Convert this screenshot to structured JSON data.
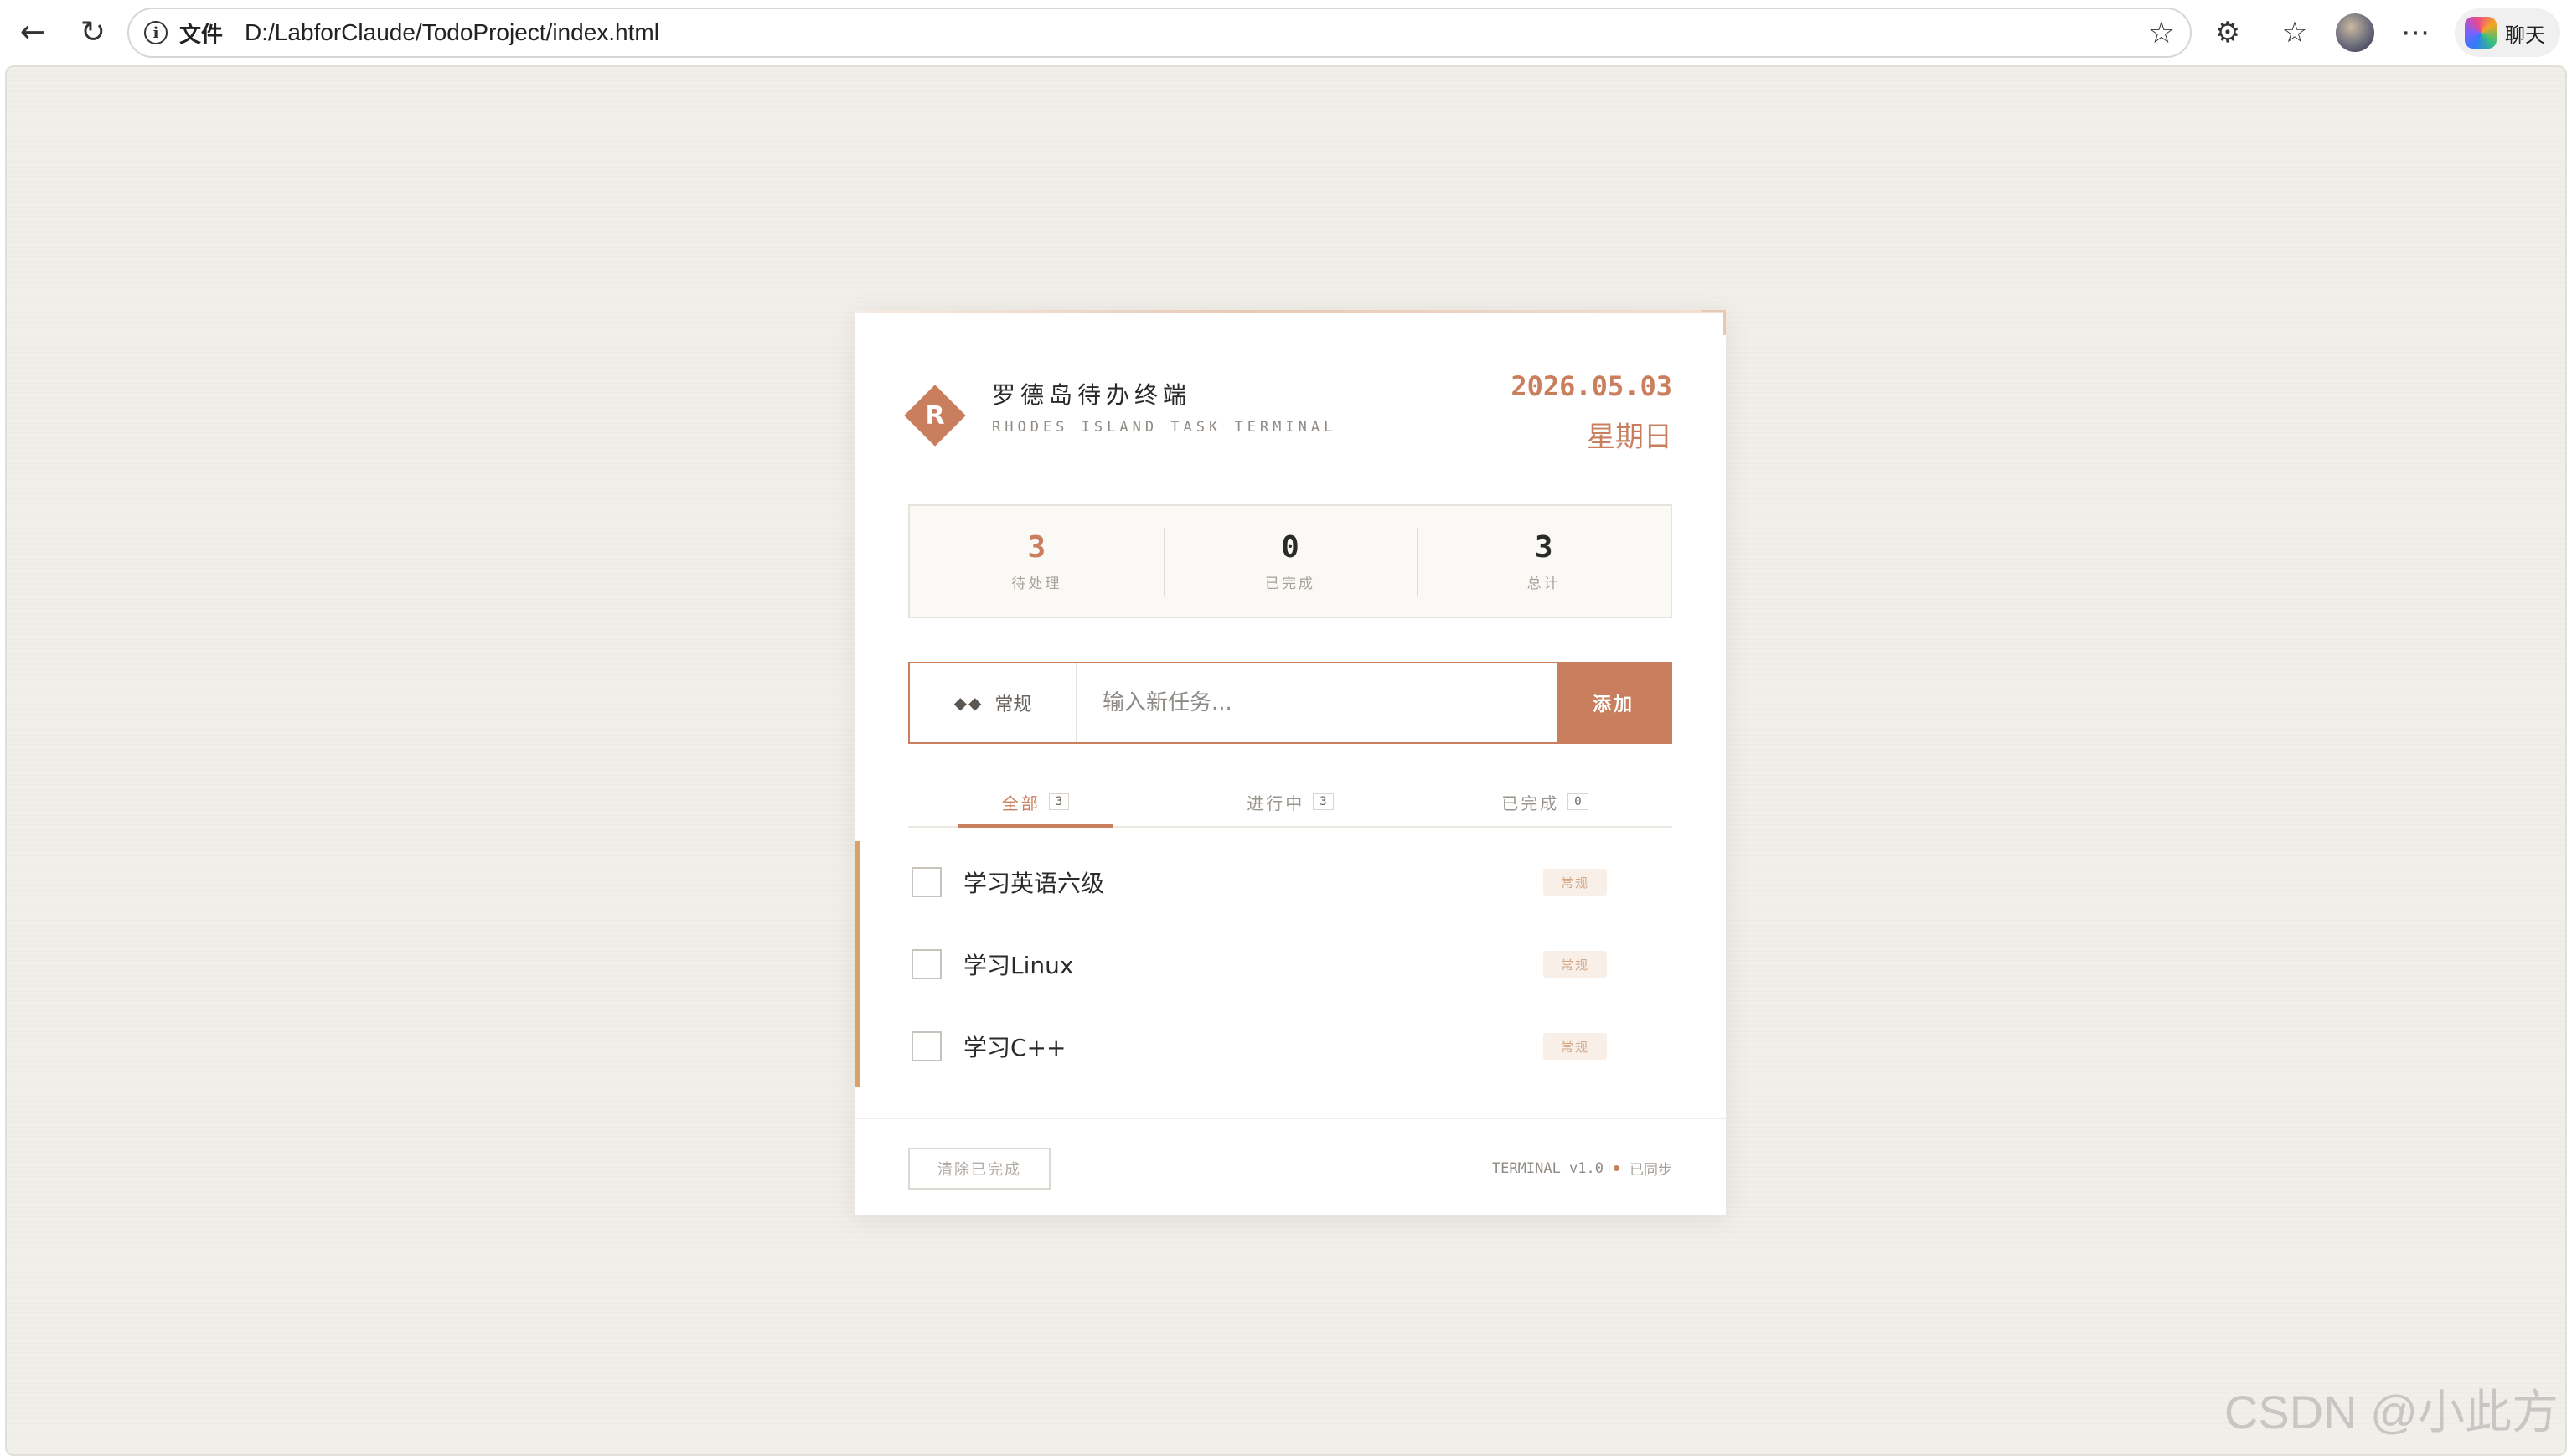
{
  "browser": {
    "address_label": "文件",
    "url": "D:/LabforClaude/TodoProject/index.html",
    "chat_label": "聊天",
    "icons": [
      "back-icon",
      "reload-icon",
      "info-icon",
      "star-icon",
      "extensions-icon",
      "favorites-icon",
      "more-icon",
      "copilot-icon"
    ]
  },
  "app": {
    "logo_letter": "R",
    "title": "罗德岛待办终端",
    "subtitle": "RHODES ISLAND TASK TERMINAL",
    "date": "2026.05.03",
    "weekday": "星期日",
    "accent_color": "#c97f5d"
  },
  "stats": [
    {
      "value": "3",
      "label": "待处理"
    },
    {
      "value": "0",
      "label": "已完成"
    },
    {
      "value": "3",
      "label": "总计"
    }
  ],
  "input": {
    "priority_icon": "◆◆",
    "priority_label": "常规",
    "placeholder": "输入新任务...",
    "add_label": "添加"
  },
  "tabs": [
    {
      "label": "全部",
      "count": "3"
    },
    {
      "label": "进行中",
      "count": "3"
    },
    {
      "label": "已完成",
      "count": "0"
    }
  ],
  "tasks": [
    {
      "text": "学习英语六级",
      "badge": "常规"
    },
    {
      "text": "学习Linux",
      "badge": "常规"
    },
    {
      "text": "学习C++",
      "badge": "常规"
    }
  ],
  "footer": {
    "clear_label": "清除已完成",
    "version": "TERMINAL v1.0",
    "sync": "已同步"
  },
  "watermark": "CSDN @小此方"
}
